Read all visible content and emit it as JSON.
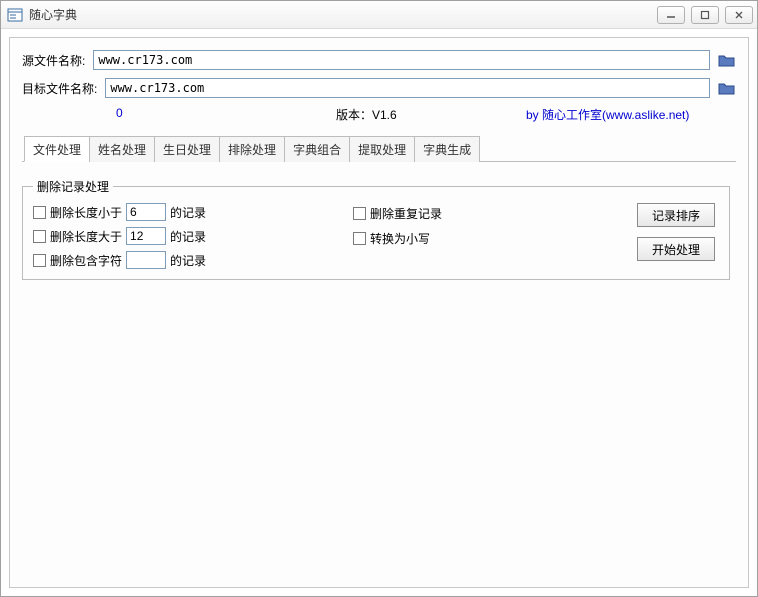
{
  "window": {
    "title": "随心字典",
    "min_tip": "最小化",
    "max_tip": "最大化",
    "close_tip": "关闭"
  },
  "files": {
    "source_label": "源文件名称:",
    "source_value": "www.cr173.com",
    "target_label": "目标文件名称:",
    "target_value": "www.cr173.com"
  },
  "info": {
    "count": "0",
    "version": "版本：V1.6",
    "author_prefix": "by 随心工作室(",
    "author_url": "www.aslike.net",
    "author_suffix": ")"
  },
  "tabs": [
    "文件处理",
    "姓名处理",
    "生日处理",
    "排除处理",
    "字典组合",
    "提取处理",
    "字典生成"
  ],
  "group": {
    "legend": "删除记录处理",
    "del_lt_label": "删除长度小于",
    "del_lt_value": "6",
    "del_gt_label": "删除长度大于",
    "del_gt_value": "12",
    "del_contains_label": "删除包含字符",
    "del_contains_value": "",
    "suffix": "的记录",
    "del_dup_label": "删除重复记录",
    "to_lower_label": "转换为小写",
    "btn_sort": "记录排序",
    "btn_process": "开始处理"
  }
}
